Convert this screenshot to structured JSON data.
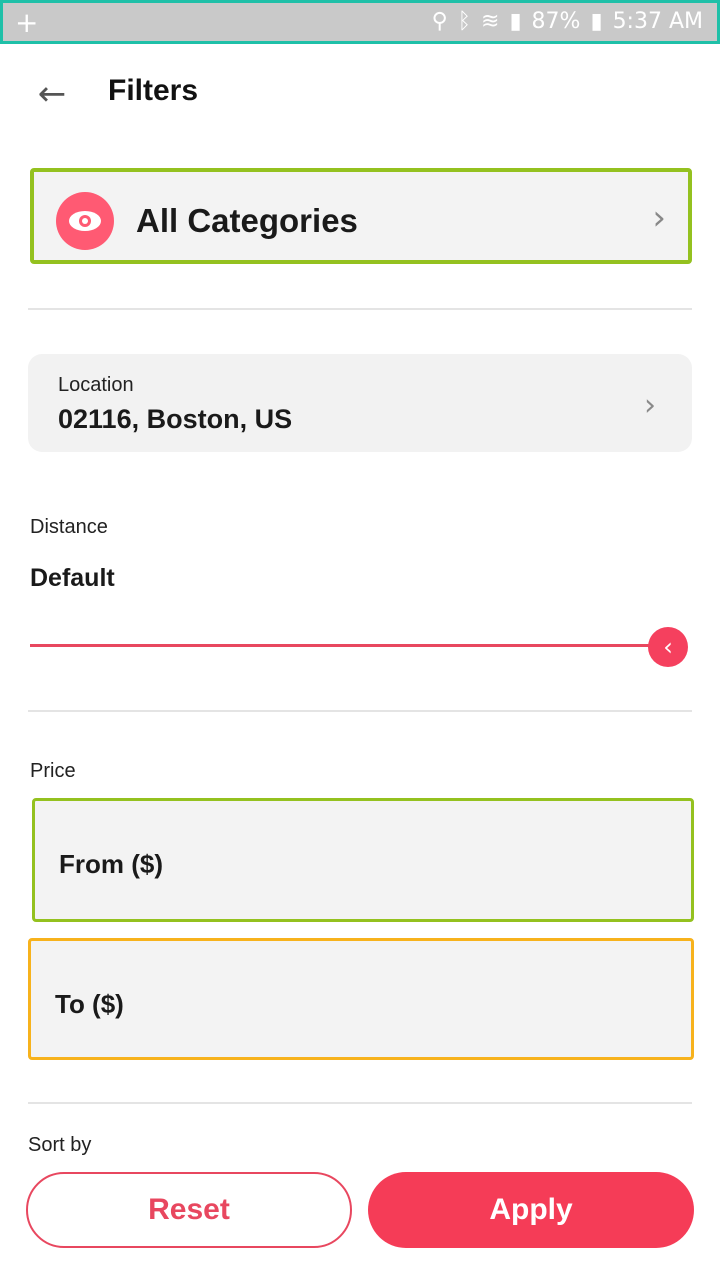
{
  "status_bar": {
    "battery": "87%",
    "time": "5:37 AM"
  },
  "header": {
    "title": "Filters"
  },
  "category": {
    "label": "All Categories"
  },
  "location": {
    "label": "Location",
    "value": "02116, Boston, US"
  },
  "distance": {
    "label": "Distance",
    "value": "Default"
  },
  "price": {
    "label": "Price",
    "from_label": "From ($)",
    "to_label": "To ($)"
  },
  "sort": {
    "label": "Sort by"
  },
  "actions": {
    "reset_label": "Reset",
    "apply_label": "Apply"
  },
  "colors": {
    "accent": "#f53c57",
    "status_bar": "#c9c9c9"
  }
}
